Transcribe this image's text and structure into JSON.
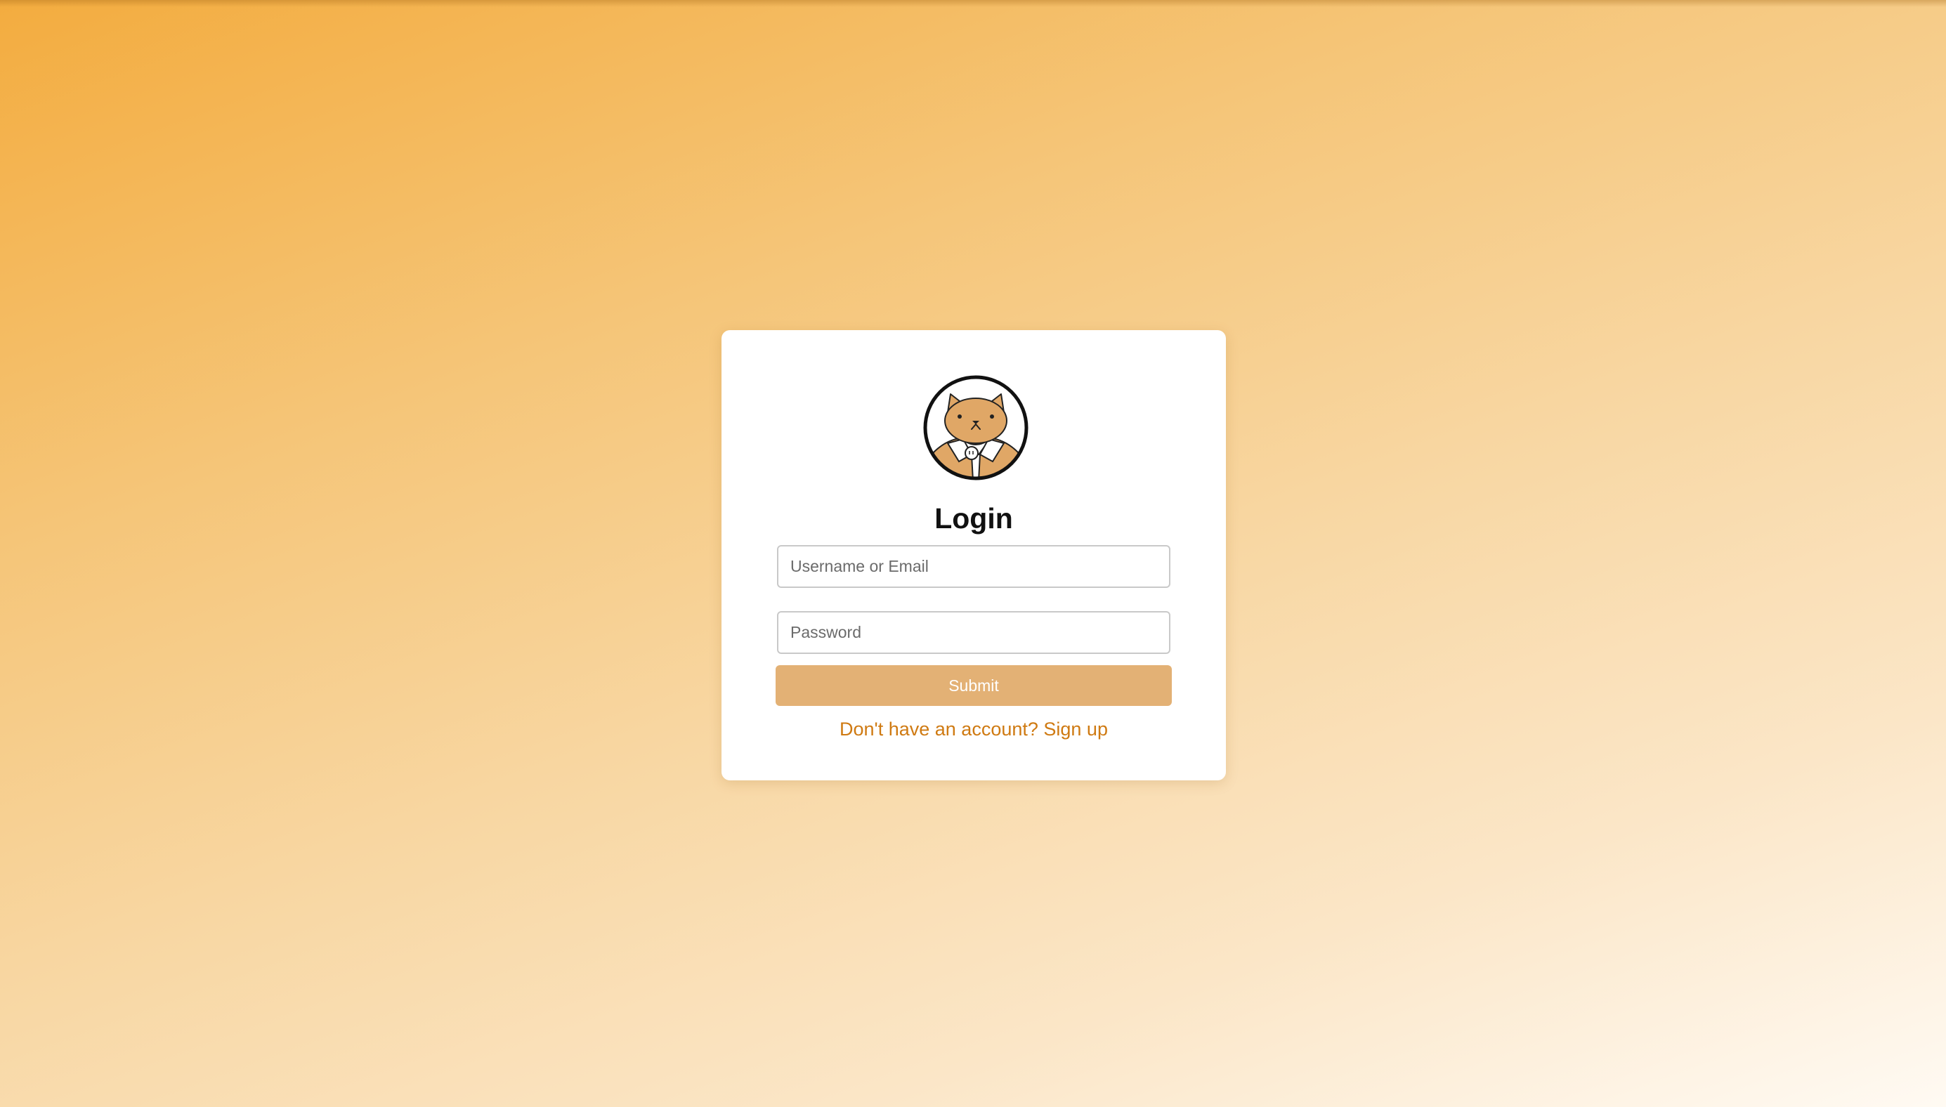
{
  "login": {
    "title": "Login",
    "username_placeholder": "Username or Email",
    "password_placeholder": "Password",
    "submit_label": "Submit",
    "signup_text": "Don't have an account? Sign up"
  },
  "icons": {
    "avatar": "cat-avatar-icon"
  },
  "colors": {
    "accent": "#e3b175",
    "link": "#cf7a12",
    "cat_fur": "#e0a766",
    "background_start": "#f3ac3f",
    "background_end": "#fffaf3"
  }
}
